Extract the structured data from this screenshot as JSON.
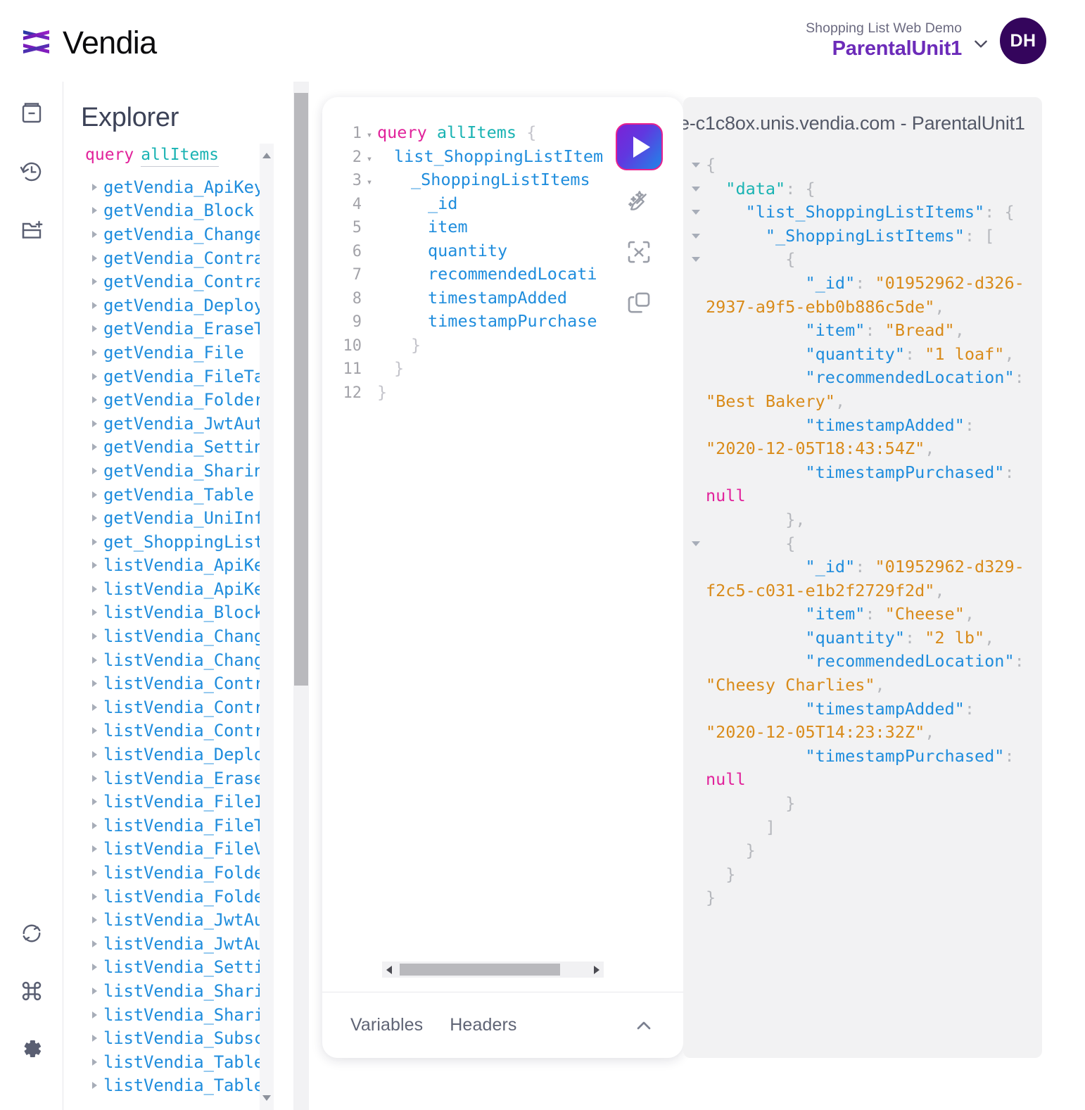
{
  "header": {
    "brand_name": "Vendia",
    "brand_logo_icon": "vendia-weave-logo-icon",
    "app_name": "Shopping List Web Demo",
    "uni_name": "ParentalUnit1",
    "chevron_icon": "chevron-down-icon",
    "avatar_initials": "DH"
  },
  "rail": {
    "items": [
      {
        "icon": "docs-book-icon",
        "name": "docs"
      },
      {
        "icon": "history-clock-icon",
        "name": "history"
      },
      {
        "icon": "new-collection-folder-icon",
        "name": "collections"
      }
    ],
    "bottom_items": [
      {
        "icon": "refresh-sync-icon",
        "name": "refresh"
      },
      {
        "icon": "keyboard-shortcuts-command-icon",
        "name": "shortcuts"
      },
      {
        "icon": "settings-gear-icon",
        "name": "settings"
      }
    ]
  },
  "explorer": {
    "title": "Explorer",
    "query_keyword": "query",
    "query_name": "allItems",
    "items": [
      "getVendia_ApiKey",
      "getVendia_Block",
      "getVendia_Change",
      "getVendia_Contra",
      "getVendia_Contra",
      "getVendia_Deploy",
      "getVendia_EraseT",
      "getVendia_File",
      "getVendia_FileTa",
      "getVendia_Folder",
      "getVendia_JwtAut",
      "getVendia_Settin",
      "getVendia_Sharin",
      "getVendia_Table",
      "getVendia_UniInf",
      "get_ShoppingList",
      "listVendia_ApiKe",
      "listVendia_ApiKe",
      "listVendia_Block",
      "listVendia_Chang",
      "listVendia_Chang",
      "listVendia_Contr",
      "listVendia_Contr",
      "listVendia_Contr",
      "listVendia_Deplo",
      "listVendia_Erase",
      "listVendia_FileI",
      "listVendia_FileT",
      "listVendia_FileV",
      "listVendia_Folde",
      "listVendia_Folde",
      "listVendia_JwtAu",
      "listVendia_JwtAu",
      "listVendia_Setti",
      "listVendia_Shari",
      "listVendia_Shari",
      "listVendia_Subsc",
      "listVendia_Table",
      "listVendia_Table"
    ]
  },
  "editor": {
    "lines": [
      {
        "n": "1",
        "fold": true,
        "indent": 0,
        "segments": [
          {
            "t": "query ",
            "c": "kw"
          },
          {
            "t": "allItems",
            "c": "name"
          },
          {
            "t": " {",
            "c": "punc"
          }
        ]
      },
      {
        "n": "2",
        "fold": true,
        "indent": 1,
        "segments": [
          {
            "t": "list_ShoppingListItem",
            "c": "txt"
          }
        ]
      },
      {
        "n": "3",
        "fold": true,
        "indent": 2,
        "segments": [
          {
            "t": "_ShoppingListItems",
            "c": "txt"
          }
        ]
      },
      {
        "n": "4",
        "fold": false,
        "indent": 3,
        "segments": [
          {
            "t": "_id",
            "c": "txt"
          }
        ]
      },
      {
        "n": "5",
        "fold": false,
        "indent": 3,
        "segments": [
          {
            "t": "item",
            "c": "txt"
          }
        ]
      },
      {
        "n": "6",
        "fold": false,
        "indent": 3,
        "segments": [
          {
            "t": "quantity",
            "c": "txt"
          }
        ]
      },
      {
        "n": "7",
        "fold": false,
        "indent": 3,
        "segments": [
          {
            "t": "recommendedLocati",
            "c": "txt"
          }
        ]
      },
      {
        "n": "8",
        "fold": false,
        "indent": 3,
        "segments": [
          {
            "t": "timestampAdded",
            "c": "txt"
          }
        ]
      },
      {
        "n": "9",
        "fold": false,
        "indent": 3,
        "segments": [
          {
            "t": "timestampPurchase",
            "c": "txt"
          }
        ]
      },
      {
        "n": "10",
        "fold": false,
        "indent": 2,
        "segments": [
          {
            "t": "}",
            "c": "punc"
          }
        ]
      },
      {
        "n": "11",
        "fold": false,
        "indent": 1,
        "segments": [
          {
            "t": "}",
            "c": "punc"
          }
        ]
      },
      {
        "n": "12",
        "fold": false,
        "indent": 0,
        "segments": [
          {
            "t": "}",
            "c": "punc"
          }
        ]
      }
    ],
    "toolbar": {
      "run_icon": "play-run-icon",
      "prettify_icon": "prettify-broom-sparkle-icon",
      "merge_icon": "merge-collapse-icon",
      "copy_icon": "copy-duplicate-icon"
    },
    "footer": {
      "variables_tab": "Variables",
      "headers_tab": "Headers",
      "collapse_icon": "chevron-up-icon"
    }
  },
  "response": {
    "title": "e-c1c8ox.unis.vendia.com - ParentalUnit1",
    "lines": [
      {
        "arrow": true,
        "segments": [
          {
            "t": "{",
            "c": "punc"
          }
        ]
      },
      {
        "arrow": true,
        "segments": [
          {
            "t": "  ",
            "c": "punc"
          },
          {
            "t": "\"data\"",
            "c": "key-teal"
          },
          {
            "t": ": {",
            "c": "punc"
          }
        ]
      },
      {
        "arrow": true,
        "segments": [
          {
            "t": "    ",
            "c": "punc"
          },
          {
            "t": "\"list_ShoppingListItems\"",
            "c": "key"
          },
          {
            "t": ": {",
            "c": "punc"
          }
        ]
      },
      {
        "arrow": true,
        "segments": [
          {
            "t": "      ",
            "c": "punc"
          },
          {
            "t": "\"_ShoppingListItems\"",
            "c": "key"
          },
          {
            "t": ": [",
            "c": "punc"
          }
        ]
      },
      {
        "arrow": true,
        "segments": [
          {
            "t": "        {",
            "c": "punc"
          }
        ]
      },
      {
        "arrow": false,
        "segments": [
          {
            "t": "          ",
            "c": "punc"
          },
          {
            "t": "\"_id\"",
            "c": "key"
          },
          {
            "t": ": ",
            "c": "punc"
          },
          {
            "t": "\"01952962-d326-2937-a9f5-ebb0b886c5de\"",
            "c": "str"
          },
          {
            "t": ",",
            "c": "punc"
          }
        ]
      },
      {
        "arrow": false,
        "segments": [
          {
            "t": "          ",
            "c": "punc"
          },
          {
            "t": "\"item\"",
            "c": "key"
          },
          {
            "t": ": ",
            "c": "punc"
          },
          {
            "t": "\"Bread\"",
            "c": "str"
          },
          {
            "t": ",",
            "c": "punc"
          }
        ]
      },
      {
        "arrow": false,
        "segments": [
          {
            "t": "          ",
            "c": "punc"
          },
          {
            "t": "\"quantity\"",
            "c": "key"
          },
          {
            "t": ": ",
            "c": "punc"
          },
          {
            "t": "\"1 loaf\"",
            "c": "str"
          },
          {
            "t": ",",
            "c": "punc"
          }
        ]
      },
      {
        "arrow": false,
        "segments": [
          {
            "t": "          ",
            "c": "punc"
          },
          {
            "t": "\"recommendedLocation\"",
            "c": "key"
          },
          {
            "t": ": ",
            "c": "punc"
          },
          {
            "t": "\"Best Bakery\"",
            "c": "str"
          },
          {
            "t": ",",
            "c": "punc"
          }
        ]
      },
      {
        "arrow": false,
        "segments": [
          {
            "t": "          ",
            "c": "punc"
          },
          {
            "t": "\"timestampAdded\"",
            "c": "key"
          },
          {
            "t": ": ",
            "c": "punc"
          },
          {
            "t": "\"2020-12-05T18:43:54Z\"",
            "c": "str"
          },
          {
            "t": ",",
            "c": "punc"
          }
        ]
      },
      {
        "arrow": false,
        "segments": [
          {
            "t": "          ",
            "c": "punc"
          },
          {
            "t": "\"timestampPurchased\"",
            "c": "key"
          },
          {
            "t": ": ",
            "c": "punc"
          },
          {
            "t": "null",
            "c": "null"
          }
        ]
      },
      {
        "arrow": false,
        "segments": [
          {
            "t": "        },",
            "c": "punc"
          }
        ]
      },
      {
        "arrow": true,
        "segments": [
          {
            "t": "        {",
            "c": "punc"
          }
        ]
      },
      {
        "arrow": false,
        "segments": [
          {
            "t": "          ",
            "c": "punc"
          },
          {
            "t": "\"_id\"",
            "c": "key"
          },
          {
            "t": ": ",
            "c": "punc"
          },
          {
            "t": "\"01952962-d329-f2c5-c031-e1b2f2729f2d\"",
            "c": "str"
          },
          {
            "t": ",",
            "c": "punc"
          }
        ]
      },
      {
        "arrow": false,
        "segments": [
          {
            "t": "          ",
            "c": "punc"
          },
          {
            "t": "\"item\"",
            "c": "key"
          },
          {
            "t": ": ",
            "c": "punc"
          },
          {
            "t": "\"Cheese\"",
            "c": "str"
          },
          {
            "t": ",",
            "c": "punc"
          }
        ]
      },
      {
        "arrow": false,
        "segments": [
          {
            "t": "          ",
            "c": "punc"
          },
          {
            "t": "\"quantity\"",
            "c": "key"
          },
          {
            "t": ": ",
            "c": "punc"
          },
          {
            "t": "\"2 lb\"",
            "c": "str"
          },
          {
            "t": ",",
            "c": "punc"
          }
        ]
      },
      {
        "arrow": false,
        "segments": [
          {
            "t": "          ",
            "c": "punc"
          },
          {
            "t": "\"recommendedLocation\"",
            "c": "key"
          },
          {
            "t": ": ",
            "c": "punc"
          },
          {
            "t": "\"Cheesy Charlies\"",
            "c": "str"
          },
          {
            "t": ",",
            "c": "punc"
          }
        ]
      },
      {
        "arrow": false,
        "segments": [
          {
            "t": "          ",
            "c": "punc"
          },
          {
            "t": "\"timestampAdded\"",
            "c": "key"
          },
          {
            "t": ": ",
            "c": "punc"
          },
          {
            "t": "\"2020-12-05T14:23:32Z\"",
            "c": "str"
          },
          {
            "t": ",",
            "c": "punc"
          }
        ]
      },
      {
        "arrow": false,
        "segments": [
          {
            "t": "          ",
            "c": "punc"
          },
          {
            "t": "\"timestampPurchased\"",
            "c": "key"
          },
          {
            "t": ": ",
            "c": "punc"
          },
          {
            "t": "null",
            "c": "null"
          }
        ]
      },
      {
        "arrow": false,
        "segments": [
          {
            "t": "        }",
            "c": "punc"
          }
        ]
      },
      {
        "arrow": false,
        "segments": [
          {
            "t": "      ]",
            "c": "punc"
          }
        ]
      },
      {
        "arrow": false,
        "segments": [
          {
            "t": "    }",
            "c": "punc"
          }
        ]
      },
      {
        "arrow": false,
        "segments": [
          {
            "t": "  }",
            "c": "punc"
          }
        ]
      },
      {
        "arrow": false,
        "segments": [
          {
            "t": "}",
            "c": "punc"
          }
        ]
      }
    ]
  }
}
